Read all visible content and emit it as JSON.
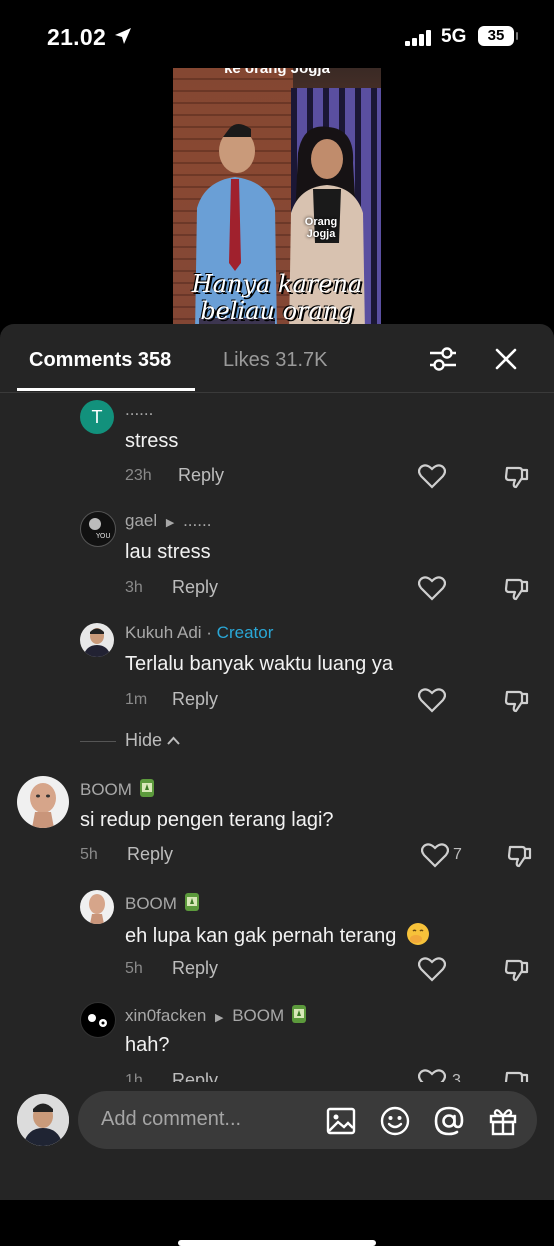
{
  "status_bar": {
    "time": "21.02",
    "network": "5G",
    "battery": "35"
  },
  "video": {
    "top_caption": "ke orang Jogja",
    "overlay_label": "Orang Jogja",
    "caption_line1": "Hanya karena",
    "caption_line2": "beliau orang"
  },
  "tabs": {
    "comments": "Comments 358",
    "likes": "Likes 31.7K"
  },
  "comments": [
    {
      "user": "......",
      "text": "stress",
      "time": "23h",
      "reply": "Reply"
    },
    {
      "user": "gael",
      "reply_to": "......",
      "text": "lau stress",
      "time": "3h",
      "reply": "Reply"
    },
    {
      "user": "Kukuh Adi",
      "badge": "Creator",
      "separator": " · ",
      "text": "Terlalu banyak waktu luang ya",
      "time": "1m",
      "reply": "Reply"
    },
    {
      "user": "BOOM",
      "text": "si redup pengen terang lagi?",
      "time": "5h",
      "reply": "Reply",
      "likes": "7"
    },
    {
      "user": "BOOM",
      "text": "eh lupa kan gak pernah terang",
      "time": "5h",
      "reply": "Reply"
    },
    {
      "user": "xin0facken",
      "reply_to": "BOOM",
      "text": "hah?",
      "time": "1h",
      "reply": "Reply",
      "likes": "3"
    }
  ],
  "hide_label": "Hide",
  "avatar_letter": "T",
  "input": {
    "placeholder": "Add comment..."
  },
  "icons": [
    "location-arrow-icon",
    "filter-icon",
    "close-icon",
    "heart-icon",
    "dislike-icon",
    "image-icon",
    "emoji-icon",
    "mention-icon",
    "gift-icon"
  ],
  "colors": {
    "sheet": "#252525",
    "creator": "#2aa7d6",
    "avatar_t": "#12917c"
  }
}
